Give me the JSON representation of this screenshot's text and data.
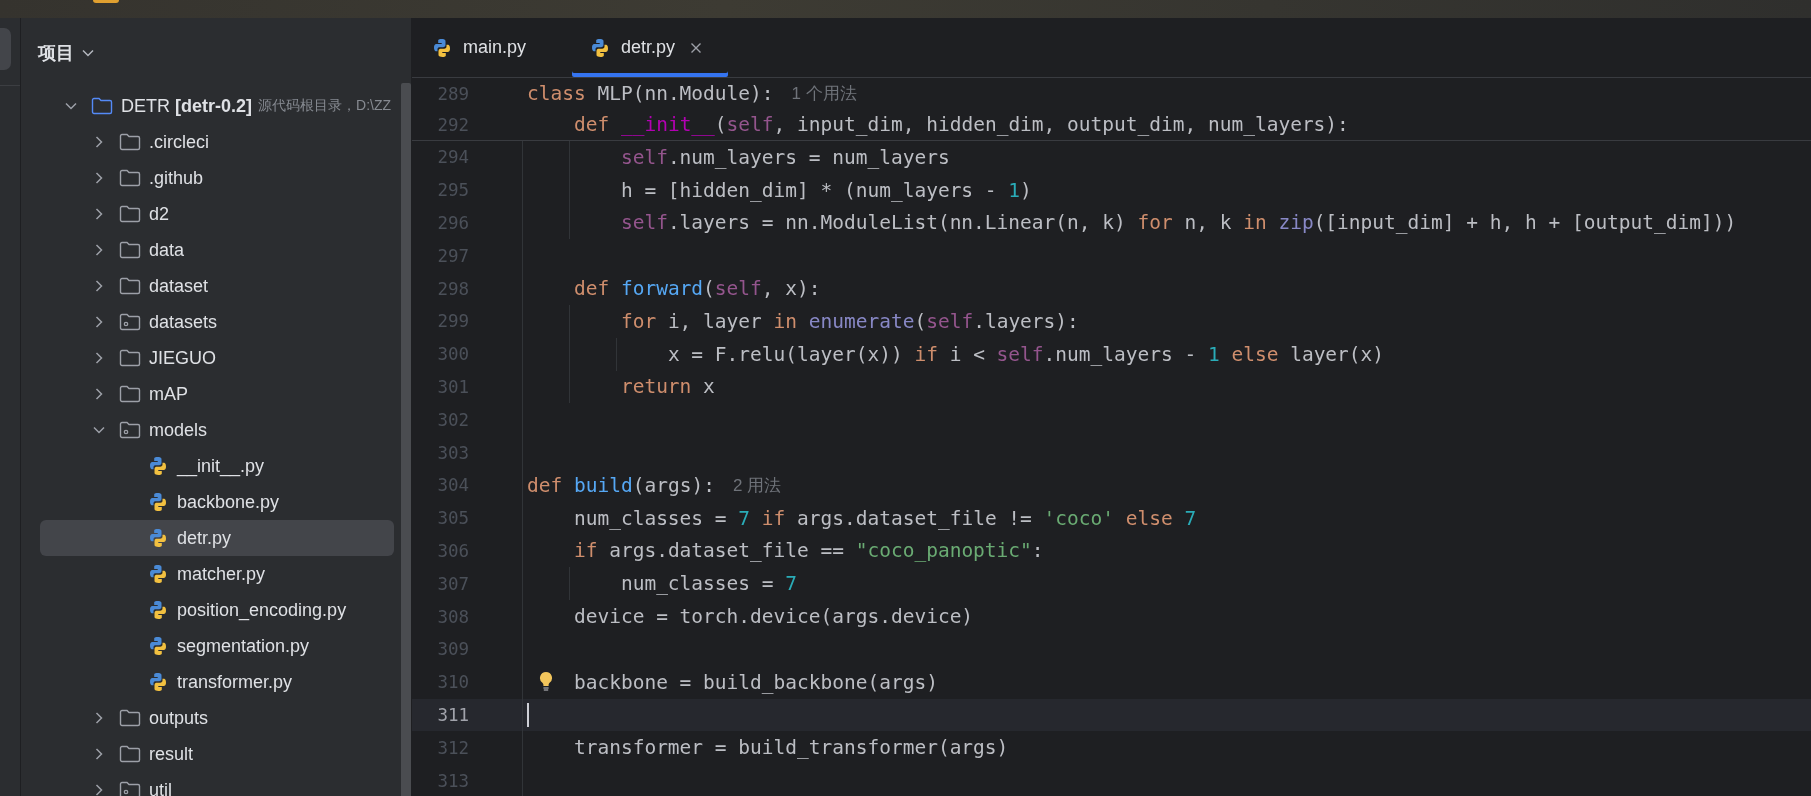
{
  "sidebar": {
    "title": "项目",
    "tree": [
      {
        "label": "DETR **[detr-0.2]**",
        "note": "源代码根目录，D:\\ZZ",
        "kind": "root",
        "expanded": true,
        "selected": false,
        "children": [
          {
            "label": ".circleci",
            "kind": "folder",
            "expanded": false,
            "selected": false
          },
          {
            "label": ".github",
            "kind": "folder",
            "expanded": false,
            "selected": false
          },
          {
            "label": "d2",
            "kind": "folder",
            "expanded": false,
            "selected": false
          },
          {
            "label": "data",
            "kind": "folder",
            "expanded": false,
            "selected": false
          },
          {
            "label": "dataset",
            "kind": "folder",
            "expanded": false,
            "selected": false
          },
          {
            "label": "datasets",
            "kind": "package",
            "expanded": false,
            "selected": false
          },
          {
            "label": "JIEGUO",
            "kind": "folder",
            "expanded": false,
            "selected": false
          },
          {
            "label": "mAP",
            "kind": "folder",
            "expanded": false,
            "selected": false
          },
          {
            "label": "models",
            "kind": "package",
            "expanded": true,
            "selected": false,
            "children": [
              {
                "label": "__init__.py",
                "kind": "python",
                "selected": false
              },
              {
                "label": "backbone.py",
                "kind": "python",
                "selected": false
              },
              {
                "label": "detr.py",
                "kind": "python",
                "selected": true
              },
              {
                "label": "matcher.py",
                "kind": "python",
                "selected": false
              },
              {
                "label": "position_encoding.py",
                "kind": "python",
                "selected": false
              },
              {
                "label": "segmentation.py",
                "kind": "python",
                "selected": false
              },
              {
                "label": "transformer.py",
                "kind": "python",
                "selected": false
              }
            ]
          },
          {
            "label": "outputs",
            "kind": "folder",
            "expanded": false,
            "selected": false
          },
          {
            "label": "result",
            "kind": "folder",
            "expanded": false,
            "selected": false
          },
          {
            "label": "util",
            "kind": "package",
            "expanded": false,
            "selected": false
          }
        ]
      }
    ]
  },
  "tabs": [
    {
      "label": "main.py",
      "selected": false
    },
    {
      "label": "detr.py",
      "selected": true
    }
  ],
  "editor": {
    "sticky_lines": [
      {
        "number": "289",
        "tokens": [
          {
            "kind": "keyword",
            "text": "class"
          },
          {
            "kind": "plain",
            "text": " MLP(nn.Module):"
          }
        ],
        "hint": "1 个用法"
      },
      {
        "number": "292",
        "tokens": [
          {
            "kind": "keyword",
            "text": "    def"
          },
          {
            "kind": "dunder",
            "text": " __init__"
          },
          {
            "kind": "plain",
            "text": "("
          },
          {
            "kind": "self",
            "text": "self"
          },
          {
            "kind": "plain",
            "text": ", input_dim, hidden_dim, output_dim, num_layers):"
          }
        ]
      }
    ],
    "lines": [
      {
        "number": "294",
        "current": false,
        "bulb": false,
        "tokens": [
          {
            "kind": "self",
            "text": "        self"
          },
          {
            "kind": "plain",
            "text": ".num_layers = num_layers"
          }
        ]
      },
      {
        "number": "295",
        "current": false,
        "bulb": false,
        "tokens": [
          {
            "kind": "plain",
            "text": "        h = [hidden_dim] * (num_layers - "
          },
          {
            "kind": "number",
            "text": "1"
          },
          {
            "kind": "plain",
            "text": ")"
          }
        ]
      },
      {
        "number": "296",
        "current": false,
        "bulb": false,
        "tokens": [
          {
            "kind": "self",
            "text": "        self"
          },
          {
            "kind": "plain",
            "text": ".layers = nn.ModuleList(nn.Linear(n, k) "
          },
          {
            "kind": "keyword",
            "text": "for"
          },
          {
            "kind": "plain",
            "text": " n, k "
          },
          {
            "kind": "keyword",
            "text": "in"
          },
          {
            "kind": "builtin",
            "text": " zip"
          },
          {
            "kind": "plain",
            "text": "([input_dim] + h, h + [output_dim]))"
          }
        ]
      },
      {
        "number": "297",
        "current": false,
        "bulb": false
      },
      {
        "number": "298",
        "current": false,
        "bulb": false,
        "tokens": [
          {
            "kind": "keyword",
            "text": "    def"
          },
          {
            "kind": "function",
            "text": " forward"
          },
          {
            "kind": "plain",
            "text": "("
          },
          {
            "kind": "self",
            "text": "self"
          },
          {
            "kind": "plain",
            "text": ", x):"
          }
        ]
      },
      {
        "number": "299",
        "current": false,
        "bulb": false,
        "tokens": [
          {
            "kind": "keyword",
            "text": "        for"
          },
          {
            "kind": "plain",
            "text": " i, layer "
          },
          {
            "kind": "keyword",
            "text": "in"
          },
          {
            "kind": "builtin",
            "text": " enumerate"
          },
          {
            "kind": "plain",
            "text": "("
          },
          {
            "kind": "self",
            "text": "self"
          },
          {
            "kind": "plain",
            "text": ".layers):"
          }
        ]
      },
      {
        "number": "300",
        "current": false,
        "bulb": false,
        "tokens": [
          {
            "kind": "plain",
            "text": "            x = F.relu(layer(x)) "
          },
          {
            "kind": "keyword",
            "text": "if"
          },
          {
            "kind": "plain",
            "text": " i < "
          },
          {
            "kind": "self",
            "text": "self"
          },
          {
            "kind": "plain",
            "text": ".num_layers - "
          },
          {
            "kind": "number",
            "text": "1"
          },
          {
            "kind": "keyword",
            "text": " else"
          },
          {
            "kind": "plain",
            "text": " layer(x)"
          }
        ]
      },
      {
        "number": "301",
        "current": false,
        "bulb": false,
        "tokens": [
          {
            "kind": "keyword",
            "text": "        return"
          },
          {
            "kind": "plain",
            "text": " x"
          }
        ]
      },
      {
        "number": "302",
        "current": false,
        "bulb": false
      },
      {
        "number": "303",
        "current": false,
        "bulb": false
      },
      {
        "number": "304",
        "current": false,
        "bulb": false,
        "tokens": [
          {
            "kind": "keyword",
            "text": "def"
          },
          {
            "kind": "function",
            "text": " build"
          },
          {
            "kind": "plain",
            "text": "(args):"
          }
        ],
        "hint": "2 用法"
      },
      {
        "number": "305",
        "current": false,
        "bulb": false,
        "tokens": [
          {
            "kind": "plain",
            "text": "    num_classes = "
          },
          {
            "kind": "number",
            "text": "7"
          },
          {
            "kind": "keyword",
            "text": " if"
          },
          {
            "kind": "plain",
            "text": " args.dataset_file != "
          },
          {
            "kind": "string",
            "text": "'coco'"
          },
          {
            "kind": "keyword",
            "text": " else"
          },
          {
            "kind": "number",
            "text": " 7"
          }
        ]
      },
      {
        "number": "306",
        "current": false,
        "bulb": false,
        "tokens": [
          {
            "kind": "keyword",
            "text": "    if"
          },
          {
            "kind": "plain",
            "text": " args.dataset_file == "
          },
          {
            "kind": "string",
            "text": "\"coco_panoptic\""
          },
          {
            "kind": "plain",
            "text": ":"
          }
        ]
      },
      {
        "number": "307",
        "current": false,
        "bulb": false,
        "tokens": [
          {
            "kind": "plain",
            "text": "        num_classes = "
          },
          {
            "kind": "number",
            "text": "7"
          }
        ]
      },
      {
        "number": "308",
        "current": false,
        "bulb": false,
        "tokens": [
          {
            "kind": "plain",
            "text": "    device = torch.device(args.device)"
          }
        ]
      },
      {
        "number": "309",
        "current": false,
        "bulb": false
      },
      {
        "number": "310",
        "current": false,
        "bulb": true,
        "tokens": [
          {
            "kind": "plain",
            "text": "    backbone = build_backbone(args)"
          }
        ]
      },
      {
        "number": "311",
        "current": true,
        "bulb": false
      },
      {
        "number": "312",
        "current": false,
        "bulb": false,
        "tokens": [
          {
            "kind": "plain",
            "text": "    transformer = build_transformer(args)"
          }
        ]
      },
      {
        "number": "313",
        "current": false,
        "bulb": false
      }
    ]
  }
}
